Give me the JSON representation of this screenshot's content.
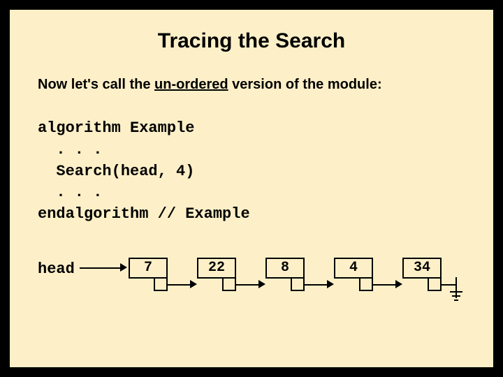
{
  "title": "Tracing the Search",
  "intro": {
    "pre": "Now let's call the ",
    "underlined": "un-ordered",
    "post": " version of the module:"
  },
  "code": {
    "l1": "algorithm Example",
    "l2": "  . . .",
    "l3": "  Search(head, 4)",
    "l4": "  . . .",
    "l5": "endalgorithm // Example"
  },
  "diagram": {
    "head_label": "head",
    "nodes": [
      "7",
      "22",
      "8",
      "4",
      "34"
    ]
  }
}
